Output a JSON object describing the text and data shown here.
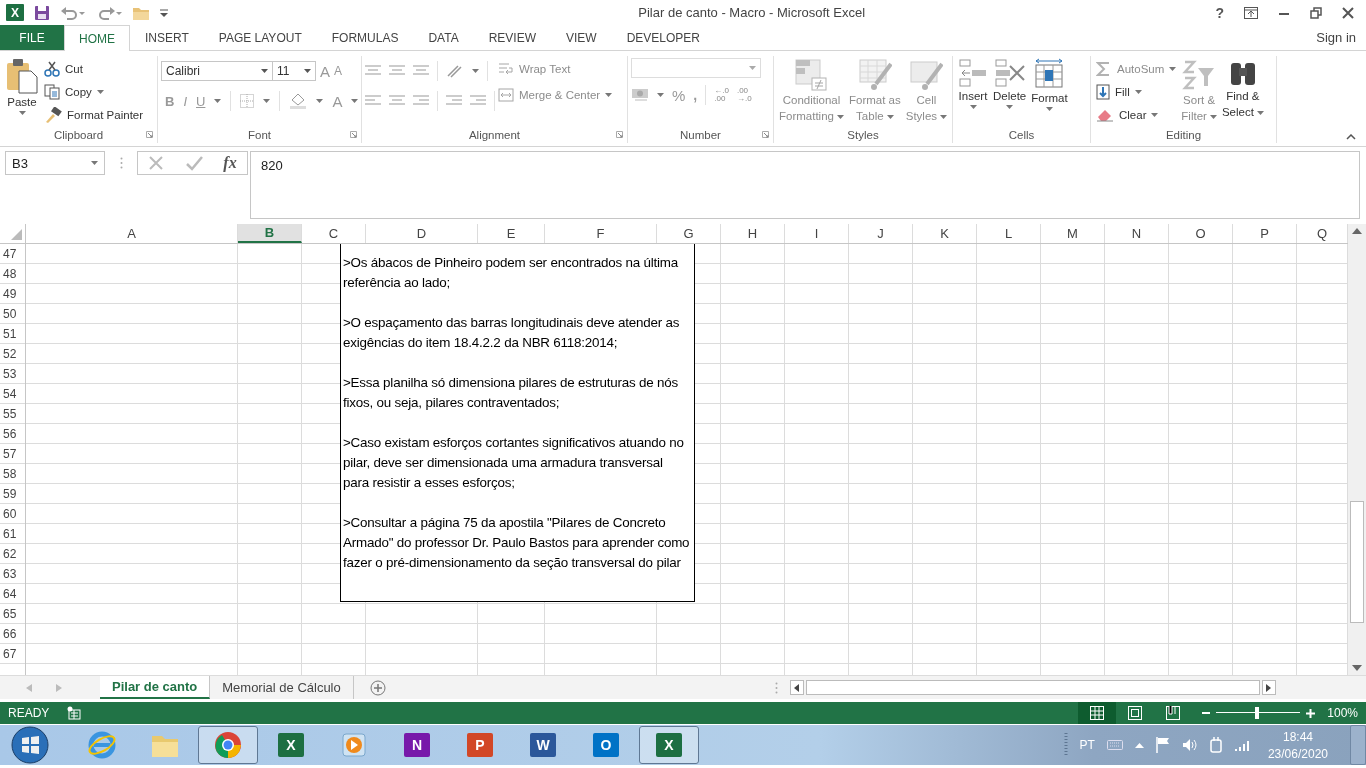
{
  "window": {
    "logo": "X",
    "title": "Pilar de canto - Macro - Microsoft Excel",
    "help": "?"
  },
  "ribbon_tabs": [
    {
      "kind": "file",
      "label": "FILE",
      "selected": false
    },
    {
      "kind": "tab",
      "label": "HOME",
      "selected": true
    },
    {
      "kind": "tab",
      "label": "INSERT",
      "selected": false
    },
    {
      "kind": "tab",
      "label": "PAGE LAYOUT",
      "selected": false
    },
    {
      "kind": "tab",
      "label": "FORMULAS",
      "selected": false
    },
    {
      "kind": "tab",
      "label": "DATA",
      "selected": false
    },
    {
      "kind": "tab",
      "label": "REVIEW",
      "selected": false
    },
    {
      "kind": "tab",
      "label": "VIEW",
      "selected": false
    },
    {
      "kind": "tab",
      "label": "DEVELOPER",
      "selected": false
    }
  ],
  "account": "Sign in",
  "ribbon_groups": [
    {
      "kind": "clipboard",
      "label": "Clipboard",
      "buttons": [
        {
          "kind": "paste",
          "lines": [
            "Paste"
          ],
          "disabled": false
        },
        {
          "kind": "cut",
          "lines": [
            "Cut"
          ],
          "disabled": false
        },
        {
          "kind": "copy",
          "lines": [
            "Copy"
          ],
          "disabled": false
        },
        {
          "kind": "format_painter",
          "lines": [
            "Format Painter"
          ],
          "disabled": false
        }
      ]
    },
    {
      "kind": "font",
      "label": "Font",
      "font_name": "Calibri",
      "font_size": "11",
      "grow": "A",
      "shrink": "A",
      "styles": [
        "B",
        "I",
        "U"
      ],
      "font_color": "A"
    },
    {
      "kind": "alignment",
      "label": "Alignment",
      "buttons": [
        {
          "kind": "wrap_text",
          "lines": [
            "Wrap Text"
          ],
          "disabled": true
        },
        {
          "kind": "merge_center",
          "lines": [
            "Merge & Center"
          ],
          "disabled": true
        }
      ]
    },
    {
      "kind": "number",
      "label": "Number",
      "symbols": [
        "%",
        ","
      ],
      "decimals": [
        {
          "top": "←.0",
          "bottom": ".00"
        },
        {
          "top": ".00",
          "bottom": "→.0"
        }
      ]
    },
    {
      "kind": "styles",
      "label": "Styles",
      "buttons": [
        {
          "kind": "conditional",
          "lines": [
            "Conditional",
            "Formatting"
          ],
          "disabled": true
        },
        {
          "kind": "format_table",
          "lines": [
            "Format as",
            "Table"
          ],
          "disabled": true
        },
        {
          "kind": "cell_styles",
          "lines": [
            "Cell",
            "Styles"
          ],
          "disabled": true
        }
      ]
    },
    {
      "kind": "cells",
      "label": "Cells",
      "buttons": [
        {
          "kind": "insert",
          "lines": [
            "Insert"
          ],
          "disabled": false
        },
        {
          "kind": "delete",
          "lines": [
            "Delete"
          ],
          "disabled": false
        },
        {
          "kind": "format",
          "lines": [
            "Format"
          ],
          "disabled": false
        }
      ]
    },
    {
      "kind": "editing",
      "label": "Editing",
      "buttons": [
        {
          "kind": "autosum",
          "lines": [
            "AutoSum"
          ],
          "disabled": true
        },
        {
          "kind": "fill",
          "lines": [
            "Fill"
          ],
          "disabled": false
        },
        {
          "kind": "clear",
          "lines": [
            "Clear"
          ],
          "disabled": false
        },
        {
          "kind": "sort_filter",
          "lines": [
            "Sort &",
            "Filter"
          ],
          "disabled": true
        },
        {
          "kind": "find",
          "lines": [
            "Find &",
            "Select"
          ],
          "disabled": false
        }
      ]
    }
  ],
  "formula_bar": {
    "name_box": "B3",
    "function_label": "fx",
    "value": "820"
  },
  "sheet": {
    "columns": [
      {
        "label": "A",
        "selected": false
      },
      {
        "label": "B",
        "selected": true
      },
      {
        "label": "C",
        "selected": false
      },
      {
        "label": "D",
        "selected": false
      },
      {
        "label": "E",
        "selected": false
      },
      {
        "label": "F",
        "selected": false
      },
      {
        "label": "G",
        "selected": false
      },
      {
        "label": "H",
        "selected": false
      },
      {
        "label": "I",
        "selected": false
      },
      {
        "label": "J",
        "selected": false
      },
      {
        "label": "K",
        "selected": false
      },
      {
        "label": "L",
        "selected": false
      },
      {
        "label": "M",
        "selected": false
      },
      {
        "label": "N",
        "selected": false
      },
      {
        "label": "O",
        "selected": false
      },
      {
        "label": "P",
        "selected": false
      },
      {
        "label": "Q",
        "selected": false
      }
    ],
    "rows": [
      "47",
      "48",
      "49",
      "50",
      "51",
      "52",
      "53",
      "54",
      "55",
      "56",
      "57",
      "58",
      "59",
      "60",
      "61",
      "62",
      "63",
      "64",
      "65",
      "66",
      "67"
    ],
    "text_box": {
      "paragraphs": [
        ">Os ábacos de Pinheiro podem ser encontrados na última referência ao lado;",
        ">O espaçamento das barras longitudinais deve atender as exigências do item 18.4.2.2 da NBR 6118:2014;",
        ">Essa planilha só dimensiona pilares de estruturas de nós fixos, ou seja, pilares contraventados;",
        ">Caso existam esforços cortantes significativos atuando no pilar, deve ser dimensionada uma armadura transversal para resistir a esses esforços;",
        ">Consultar a página 75 da apostila \"Pilares de Concreto Armado\" do professor Dr. Paulo Bastos para aprender como fazer o pré-dimensionamento da seção transversal do pilar"
      ]
    }
  },
  "sheet_tabs": [
    {
      "label": "Pilar de canto",
      "selected": true
    },
    {
      "label": "Memorial de Cálculo",
      "selected": false
    }
  ],
  "status_bar": {
    "mode": "READY",
    "views": [
      {
        "kind": "normal",
        "selected": true
      },
      {
        "kind": "page_layout",
        "selected": false
      },
      {
        "kind": "page_break",
        "selected": false
      }
    ],
    "zoom_level": {
      "level": 0.48
    },
    "zoom": "100%"
  },
  "taskbar": {
    "apps": [
      {
        "kind": "ie",
        "selected": false
      },
      {
        "kind": "explorer",
        "selected": false
      },
      {
        "kind": "chrome",
        "selected": true
      },
      {
        "kind": "excel",
        "badge": "X",
        "selected": false
      },
      {
        "kind": "media",
        "selected": false
      },
      {
        "kind": "onenote",
        "badge": "N",
        "selected": false
      },
      {
        "kind": "powerpoint",
        "badge": "P",
        "selected": false
      },
      {
        "kind": "word",
        "badge": "W",
        "selected": false
      },
      {
        "kind": "outlook",
        "badge": "O",
        "selected": false
      },
      {
        "kind": "excel_window",
        "badge": "X",
        "selected": true
      }
    ],
    "language": "PT",
    "time": "18:44",
    "date": "23/06/2020"
  }
}
